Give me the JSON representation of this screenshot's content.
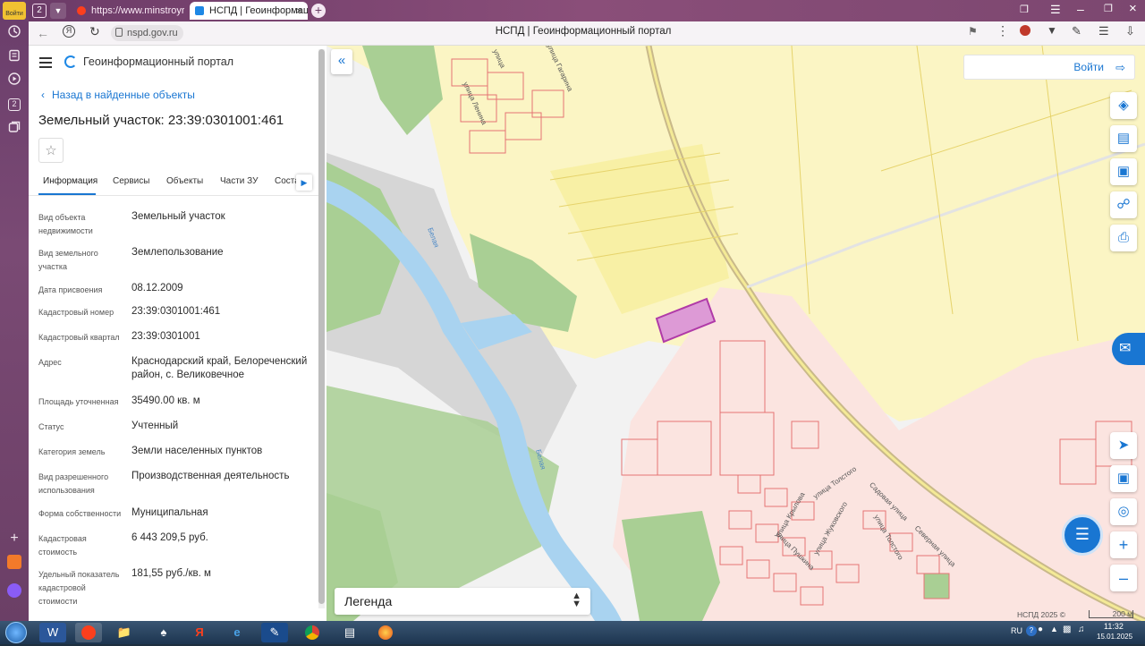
{
  "browser": {
    "tab_count": "2",
    "tabs": [
      {
        "label": "https://www.minstroyrf.g"
      },
      {
        "label": "НСПД | Геоинформацио"
      }
    ],
    "address": "nspd.gov.ru",
    "page_title": "НСПД | Геоинформационный портал",
    "rail_login": "Войти"
  },
  "panel": {
    "portal_title": "Геоинформационный портал",
    "back_label": "Назад в найденные объекты",
    "object_title": "Земельный участок: 23:39:0301001:461",
    "tabs": [
      "Информация",
      "Сервисы",
      "Объекты",
      "Части ЗУ",
      "Соста"
    ],
    "fields": [
      {
        "label": "Вид объекта недвижимости",
        "value": "Земельный участок"
      },
      {
        "label": "Вид земельного участка",
        "value": "Землепользование"
      },
      {
        "label": "Дата присвоения",
        "value": "08.12.2009"
      },
      {
        "label": "Кадастровый номер",
        "value": "23:39:0301001:461"
      },
      {
        "label": "Кадастровый квартал",
        "value": "23:39:0301001"
      },
      {
        "label": "Адрес",
        "value": "Краснодарский край, Белореченский район, с. Великовечное"
      },
      {
        "label": "Площадь уточненная",
        "value": "35490.00 кв. м"
      },
      {
        "label": "Статус",
        "value": "Учтенный"
      },
      {
        "label": "Категория земель",
        "value": "Земли населенных пунктов"
      },
      {
        "label": "Вид разрешенного использования",
        "value": "Производственная деятельность"
      },
      {
        "label": "Форма собственности",
        "value": "Муниципальная"
      },
      {
        "label": "Кадастровая стоимость",
        "value": "6 443 209,5 руб."
      },
      {
        "label": "Удельный показатель кадастровой стоимости",
        "value": "181,55 руб./кв. м"
      }
    ]
  },
  "map": {
    "login_label": "Войти",
    "legend_label": "Легенда",
    "copyright": "НСПД 2025 ©",
    "scale": "200 м",
    "labels": {
      "lenina1": "улица Ленина",
      "gagarina": "улица Гагарина",
      "lenina2": "улица",
      "belaya1": "Белая",
      "belaya2": "Белая",
      "tolstogo": "улица Толстого",
      "krylova": "улица Крылова",
      "zhukovskogo": "улица Жуковского",
      "pushkina": "улица Пушкина",
      "tolstogo2": "улица Толстого",
      "severnaya": "Северная улица",
      "sadovaya": "Садовая улица"
    }
  },
  "taskbar": {
    "lang": "RU",
    "time": "11:32",
    "date": "15.01.2025"
  },
  "colors": {
    "accent": "#1976d2",
    "parcel_highlight": "#b03aa8",
    "settlement_fill": "#fbe4e0",
    "agri_fill": "#fbf5c4",
    "forest_fill": "#a9cf94",
    "water": "#a9d3f0"
  }
}
